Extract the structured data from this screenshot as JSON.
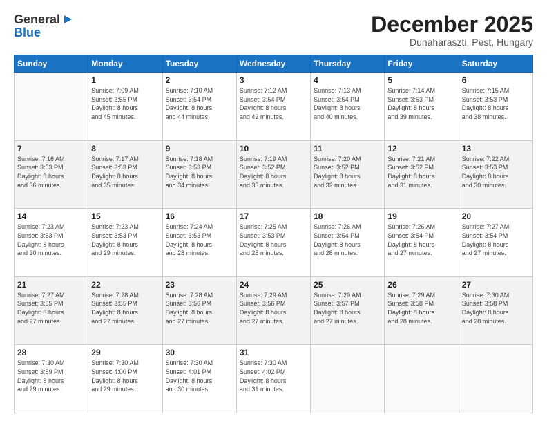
{
  "header": {
    "logo_general": "General",
    "logo_blue": "Blue",
    "month_title": "December 2025",
    "location": "Dunaharaszti, Pest, Hungary"
  },
  "weekdays": [
    "Sunday",
    "Monday",
    "Tuesday",
    "Wednesday",
    "Thursday",
    "Friday",
    "Saturday"
  ],
  "weeks": [
    [
      {
        "day": "",
        "info": ""
      },
      {
        "day": "1",
        "info": "Sunrise: 7:09 AM\nSunset: 3:55 PM\nDaylight: 8 hours\nand 45 minutes."
      },
      {
        "day": "2",
        "info": "Sunrise: 7:10 AM\nSunset: 3:54 PM\nDaylight: 8 hours\nand 44 minutes."
      },
      {
        "day": "3",
        "info": "Sunrise: 7:12 AM\nSunset: 3:54 PM\nDaylight: 8 hours\nand 42 minutes."
      },
      {
        "day": "4",
        "info": "Sunrise: 7:13 AM\nSunset: 3:54 PM\nDaylight: 8 hours\nand 40 minutes."
      },
      {
        "day": "5",
        "info": "Sunrise: 7:14 AM\nSunset: 3:53 PM\nDaylight: 8 hours\nand 39 minutes."
      },
      {
        "day": "6",
        "info": "Sunrise: 7:15 AM\nSunset: 3:53 PM\nDaylight: 8 hours\nand 38 minutes."
      }
    ],
    [
      {
        "day": "7",
        "info": "Sunrise: 7:16 AM\nSunset: 3:53 PM\nDaylight: 8 hours\nand 36 minutes."
      },
      {
        "day": "8",
        "info": "Sunrise: 7:17 AM\nSunset: 3:53 PM\nDaylight: 8 hours\nand 35 minutes."
      },
      {
        "day": "9",
        "info": "Sunrise: 7:18 AM\nSunset: 3:53 PM\nDaylight: 8 hours\nand 34 minutes."
      },
      {
        "day": "10",
        "info": "Sunrise: 7:19 AM\nSunset: 3:52 PM\nDaylight: 8 hours\nand 33 minutes."
      },
      {
        "day": "11",
        "info": "Sunrise: 7:20 AM\nSunset: 3:52 PM\nDaylight: 8 hours\nand 32 minutes."
      },
      {
        "day": "12",
        "info": "Sunrise: 7:21 AM\nSunset: 3:52 PM\nDaylight: 8 hours\nand 31 minutes."
      },
      {
        "day": "13",
        "info": "Sunrise: 7:22 AM\nSunset: 3:53 PM\nDaylight: 8 hours\nand 30 minutes."
      }
    ],
    [
      {
        "day": "14",
        "info": "Sunrise: 7:23 AM\nSunset: 3:53 PM\nDaylight: 8 hours\nand 30 minutes."
      },
      {
        "day": "15",
        "info": "Sunrise: 7:23 AM\nSunset: 3:53 PM\nDaylight: 8 hours\nand 29 minutes."
      },
      {
        "day": "16",
        "info": "Sunrise: 7:24 AM\nSunset: 3:53 PM\nDaylight: 8 hours\nand 28 minutes."
      },
      {
        "day": "17",
        "info": "Sunrise: 7:25 AM\nSunset: 3:53 PM\nDaylight: 8 hours\nand 28 minutes."
      },
      {
        "day": "18",
        "info": "Sunrise: 7:26 AM\nSunset: 3:54 PM\nDaylight: 8 hours\nand 28 minutes."
      },
      {
        "day": "19",
        "info": "Sunrise: 7:26 AM\nSunset: 3:54 PM\nDaylight: 8 hours\nand 27 minutes."
      },
      {
        "day": "20",
        "info": "Sunrise: 7:27 AM\nSunset: 3:54 PM\nDaylight: 8 hours\nand 27 minutes."
      }
    ],
    [
      {
        "day": "21",
        "info": "Sunrise: 7:27 AM\nSunset: 3:55 PM\nDaylight: 8 hours\nand 27 minutes."
      },
      {
        "day": "22",
        "info": "Sunrise: 7:28 AM\nSunset: 3:55 PM\nDaylight: 8 hours\nand 27 minutes."
      },
      {
        "day": "23",
        "info": "Sunrise: 7:28 AM\nSunset: 3:56 PM\nDaylight: 8 hours\nand 27 minutes."
      },
      {
        "day": "24",
        "info": "Sunrise: 7:29 AM\nSunset: 3:56 PM\nDaylight: 8 hours\nand 27 minutes."
      },
      {
        "day": "25",
        "info": "Sunrise: 7:29 AM\nSunset: 3:57 PM\nDaylight: 8 hours\nand 27 minutes."
      },
      {
        "day": "26",
        "info": "Sunrise: 7:29 AM\nSunset: 3:58 PM\nDaylight: 8 hours\nand 28 minutes."
      },
      {
        "day": "27",
        "info": "Sunrise: 7:30 AM\nSunset: 3:58 PM\nDaylight: 8 hours\nand 28 minutes."
      }
    ],
    [
      {
        "day": "28",
        "info": "Sunrise: 7:30 AM\nSunset: 3:59 PM\nDaylight: 8 hours\nand 29 minutes."
      },
      {
        "day": "29",
        "info": "Sunrise: 7:30 AM\nSunset: 4:00 PM\nDaylight: 8 hours\nand 29 minutes."
      },
      {
        "day": "30",
        "info": "Sunrise: 7:30 AM\nSunset: 4:01 PM\nDaylight: 8 hours\nand 30 minutes."
      },
      {
        "day": "31",
        "info": "Sunrise: 7:30 AM\nSunset: 4:02 PM\nDaylight: 8 hours\nand 31 minutes."
      },
      {
        "day": "",
        "info": ""
      },
      {
        "day": "",
        "info": ""
      },
      {
        "day": "",
        "info": ""
      }
    ]
  ]
}
